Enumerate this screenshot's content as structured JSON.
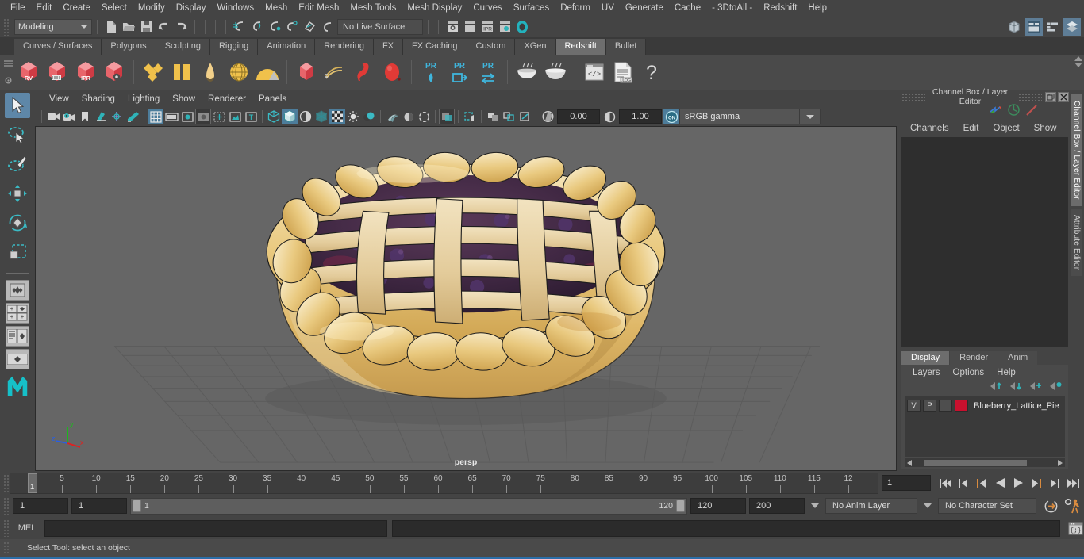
{
  "menubar": {
    "items": [
      {
        "label": "File"
      },
      {
        "label": "Edit"
      },
      {
        "label": "Create"
      },
      {
        "label": "Select"
      },
      {
        "label": "Modify"
      },
      {
        "label": "Display"
      },
      {
        "label": "Windows"
      },
      {
        "label": "Mesh"
      },
      {
        "label": "Edit Mesh"
      },
      {
        "label": "Mesh Tools"
      },
      {
        "label": "Mesh Display"
      },
      {
        "label": "Curves"
      },
      {
        "label": "Surfaces"
      },
      {
        "label": "Deform"
      },
      {
        "label": "UV"
      },
      {
        "label": "Generate"
      },
      {
        "label": "Cache"
      },
      {
        "label": "- 3DtoAll -"
      },
      {
        "label": "Redshift"
      },
      {
        "label": "Help"
      }
    ]
  },
  "statusline": {
    "menuset": "Modeling",
    "live_surface": "No Live Surface",
    "icons": [
      "new-scene-icon",
      "open-scene-icon",
      "save-scene-icon",
      "undo-icon",
      "redo-icon",
      "snap-grid-icon",
      "snap-curve-icon",
      "snap-point-icon",
      "snap-projected-center-icon",
      "snap-view-plane-icon",
      "make-live-icon",
      "render-view-icon",
      "render-sequence-icon",
      "ipr-render-icon",
      "render-settings-icon",
      "toggle-light-icon"
    ],
    "right_icons": [
      "show-hide-modeling-toolkit-icon",
      "show-hide-attribute-editor-icon",
      "show-hide-tool-settings-icon",
      "show-hide-channel-box-icon"
    ]
  },
  "shelf": {
    "tabs": [
      {
        "label": "Curves / Surfaces",
        "active": false
      },
      {
        "label": "Polygons",
        "active": false
      },
      {
        "label": "Sculpting",
        "active": false
      },
      {
        "label": "Rigging",
        "active": false
      },
      {
        "label": "Animation",
        "active": false
      },
      {
        "label": "Rendering",
        "active": false
      },
      {
        "label": "FX",
        "active": false
      },
      {
        "label": "FX Caching",
        "active": false
      },
      {
        "label": "Custom",
        "active": false
      },
      {
        "label": "XGen",
        "active": false
      },
      {
        "label": "Redshift",
        "active": true
      },
      {
        "label": "Bullet",
        "active": false
      }
    ],
    "buttons": [
      {
        "name": "redshift-render-view",
        "badge": "RV"
      },
      {
        "name": "redshift-render-sequence",
        "badge": ""
      },
      {
        "name": "redshift-ipr-render",
        "badge": "IPR"
      },
      {
        "name": "redshift-render-settings",
        "badge": ""
      },
      {
        "name": "redshift-area-light",
        "badge": ""
      },
      {
        "name": "redshift-portal-light",
        "badge": ""
      },
      {
        "name": "redshift-ies-light",
        "badge": ""
      },
      {
        "name": "redshift-dome-light",
        "badge": ""
      },
      {
        "name": "redshift-physical-sun",
        "badge": ""
      },
      {
        "name": "redshift-proxy",
        "badge": ""
      },
      {
        "name": "redshift-hair",
        "badge": ""
      },
      {
        "name": "redshift-volume",
        "badge": ""
      },
      {
        "name": "redshift-sphere-primitive",
        "badge": ""
      },
      {
        "name": "redshift-pr-light",
        "badge": "PR"
      },
      {
        "name": "redshift-pr-export",
        "badge": "PR"
      },
      {
        "name": "redshift-pr-swap",
        "badge": "PR"
      },
      {
        "name": "redshift-bake-set",
        "badge": ""
      },
      {
        "name": "redshift-bake-all",
        "badge": ""
      },
      {
        "name": "redshift-script-editor",
        "badge": ""
      },
      {
        "name": "redshift-log",
        "badge": ".LOG"
      },
      {
        "name": "redshift-help",
        "badge": "?"
      }
    ]
  },
  "toolbox": {
    "tools": [
      {
        "name": "select-tool",
        "active": true
      },
      {
        "name": "lasso-select-tool",
        "active": false
      },
      {
        "name": "paint-select-tool",
        "active": false
      },
      {
        "name": "move-tool",
        "active": false
      },
      {
        "name": "rotate-tool",
        "active": false
      },
      {
        "name": "scale-tool",
        "active": false
      }
    ],
    "layouts": [
      "single-perspective-layout",
      "four-view-layout",
      "outliner-persp-layout",
      "hypershade-layout"
    ]
  },
  "viewport": {
    "menus": [
      {
        "label": "View"
      },
      {
        "label": "Shading"
      },
      {
        "label": "Lighting"
      },
      {
        "label": "Show"
      },
      {
        "label": "Renderer"
      },
      {
        "label": "Panels"
      }
    ],
    "camera_label": "persp",
    "exposure": "0.00",
    "gamma": "1.00",
    "color_profile": "sRGB gamma",
    "axis": {
      "x": "x",
      "y": "y",
      "z": "z"
    },
    "toolbar_icons": [
      "select-camera-icon",
      "camera-attributes-icon",
      "bookmark-icon",
      "image-plane-icon",
      "two-d-pan-zoom-icon",
      "grease-pencil-icon",
      "grid-toggle-icon",
      "film-gate-icon",
      "resolution-gate-icon",
      "gate-mask-icon",
      "film-origin-icon",
      "safe-action-icon",
      "title-safe-icon",
      "wireframe-icon",
      "smooth-shade-icon",
      "shade-wireframe-icon",
      "textured-icon",
      "use-default-material-icon",
      "lighting-icon",
      "shadows-icon",
      "screen-space-ao-icon",
      "motion-blur-icon",
      "multisample-icon",
      "isolate-select-icon",
      "xray-icon",
      "xray-joints-icon",
      "xray-active-components-icon",
      "exposure-icon",
      "gamma-icon",
      "color-management-icon"
    ]
  },
  "channelbox": {
    "title": "Channel Box / Layer Editor",
    "menus": [
      {
        "label": "Channels"
      },
      {
        "label": "Edit"
      },
      {
        "label": "Object"
      },
      {
        "label": "Show"
      }
    ],
    "window_buttons": [
      "undock-icon",
      "close-icon"
    ],
    "header_icons": [
      "channel-box-icon",
      "attribute-editor-icon",
      "tool-settings-icon"
    ]
  },
  "layereditor": {
    "tabs": [
      {
        "label": "Display",
        "active": true
      },
      {
        "label": "Render",
        "active": false
      },
      {
        "label": "Anim",
        "active": false
      }
    ],
    "menus": [
      {
        "label": "Layers"
      },
      {
        "label": "Options"
      },
      {
        "label": "Help"
      }
    ],
    "tool_icons": [
      "move-layer-up-icon",
      "move-layer-down-icon",
      "new-layer-icon",
      "new-layer-from-selected-icon"
    ],
    "layers": [
      {
        "visibility": "V",
        "playback": "P",
        "shading": "",
        "color": "#c8102e",
        "name": "Blueberry_Lattice_Pie"
      }
    ]
  },
  "sidetabs": [
    {
      "label": "Channel Box / Layer Editor",
      "active": true
    },
    {
      "label": "Attribute Editor",
      "active": false
    }
  ],
  "timeline": {
    "start": 1,
    "end": 120,
    "current_frame": "1",
    "tick_labels": [
      "5",
      "10",
      "15",
      "20",
      "25",
      "30",
      "35",
      "40",
      "45",
      "50",
      "55",
      "60",
      "65",
      "70",
      "75",
      "80",
      "85",
      "90",
      "95",
      "100",
      "105",
      "110",
      "115",
      "12"
    ],
    "playhead_label": "1",
    "transport": [
      "go-to-start-icon",
      "step-back-keyframe-icon",
      "step-back-frame-icon",
      "play-backwards-icon",
      "play-forwards-icon",
      "step-forward-frame-icon",
      "step-forward-keyframe-icon",
      "go-to-end-icon"
    ]
  },
  "rangeslider": {
    "anim_start": "1",
    "range_start": "1",
    "bar_start_label": "1",
    "bar_end_label": "120",
    "range_end": "120",
    "anim_end": "200",
    "anim_layer": "No Anim Layer",
    "character_set": "No Character Set",
    "right_icons": [
      "auto-key-icon",
      "animation-preferences-icon"
    ]
  },
  "commandline": {
    "language_label": "MEL",
    "input_value": "",
    "output_value": "",
    "script_editor_icon": "script-editor-icon"
  },
  "statusbar": {
    "message": "Select Tool: select an object"
  },
  "colors": {
    "accent_blue": "#5e87a8",
    "shelf_active": "#6e6e6e",
    "layer_color": "#c8102e",
    "viewport_bg": "#666666",
    "orange": "#d98b3f"
  }
}
